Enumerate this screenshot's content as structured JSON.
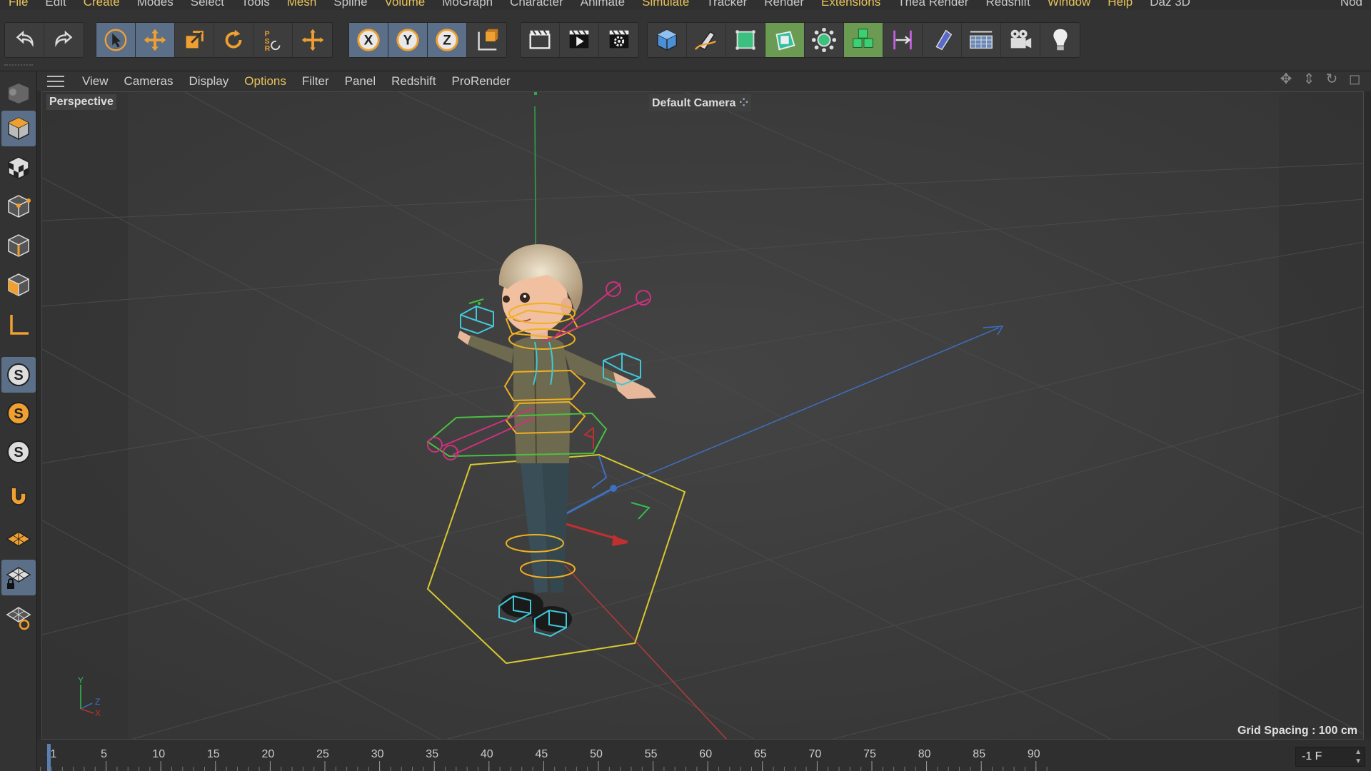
{
  "menu": {
    "items": [
      {
        "label": "File",
        "hl": true
      },
      {
        "label": "Edit",
        "hl": false
      },
      {
        "label": "Create",
        "hl": true
      },
      {
        "label": "Modes",
        "hl": false
      },
      {
        "label": "Select",
        "hl": false
      },
      {
        "label": "Tools",
        "hl": false
      },
      {
        "label": "Mesh",
        "hl": true
      },
      {
        "label": "Spline",
        "hl": false
      },
      {
        "label": "Volume",
        "hl": true
      },
      {
        "label": "MoGraph",
        "hl": false
      },
      {
        "label": "Character",
        "hl": false
      },
      {
        "label": "Animate",
        "hl": false
      },
      {
        "label": "Simulate",
        "hl": true
      },
      {
        "label": "Tracker",
        "hl": false
      },
      {
        "label": "Render",
        "hl": false
      },
      {
        "label": "Extensions",
        "hl": true
      },
      {
        "label": "Thea Render",
        "hl": false
      },
      {
        "label": "Redshift",
        "hl": false
      },
      {
        "label": "Window",
        "hl": true
      },
      {
        "label": "Help",
        "hl": true
      },
      {
        "label": "Daz 3D",
        "hl": false
      }
    ],
    "right_label": "Nod"
  },
  "toolbar": {
    "groups": [
      {
        "buttons": [
          {
            "icon": "undo-icon"
          },
          {
            "icon": "redo-icon"
          }
        ]
      },
      {
        "buttons": [
          {
            "icon": "select-arrow-icon",
            "active": true
          },
          {
            "icon": "move-icon",
            "active": true
          },
          {
            "icon": "scale-icon"
          },
          {
            "icon": "rotate-icon"
          },
          {
            "icon": "psr-icon"
          },
          {
            "icon": "add-icon"
          }
        ]
      },
      {
        "buttons": [
          {
            "icon": "x-axis-icon",
            "active": true
          },
          {
            "icon": "y-axis-icon",
            "active": true
          },
          {
            "icon": "z-axis-icon",
            "active": true
          },
          {
            "icon": "coordinate-system-icon"
          }
        ]
      },
      {
        "buttons": [
          {
            "icon": "render-region-icon"
          },
          {
            "icon": "render-view-icon"
          },
          {
            "icon": "render-settings-icon"
          }
        ]
      },
      {
        "buttons": [
          {
            "icon": "cube-icon"
          },
          {
            "icon": "pen-icon"
          },
          {
            "icon": "subdivision-icon"
          },
          {
            "icon": "extrude-icon",
            "green": true
          },
          {
            "icon": "mograph-cloner-icon"
          },
          {
            "icon": "cubes-icon",
            "green": true
          },
          {
            "icon": "deformer-icon"
          },
          {
            "icon": "field-icon"
          },
          {
            "icon": "floor-icon"
          },
          {
            "icon": "camera-icon"
          },
          {
            "icon": "light-icon"
          }
        ]
      }
    ]
  },
  "leftbar": {
    "buttons": [
      {
        "icon": "make-editable-icon",
        "sel": false
      },
      {
        "icon": "model-mode-icon",
        "sel": true
      },
      {
        "icon": "texture-mode-icon",
        "sel": false
      },
      {
        "icon": "points-mode-icon",
        "sel": false
      },
      {
        "icon": "edges-mode-icon",
        "sel": false
      },
      {
        "icon": "polygons-mode-icon",
        "sel": false
      },
      {
        "icon": "axis-mode-icon",
        "sel": false
      },
      {
        "icon": "snap-icon",
        "sel": true
      },
      {
        "icon": "snap-settings-icon",
        "sel": false
      },
      {
        "icon": "solo-icon",
        "sel": false
      },
      {
        "icon": "magnet-icon",
        "sel": false
      },
      {
        "icon": "workplane-icon",
        "sel": false
      },
      {
        "icon": "lock-workplane-icon",
        "sel": true
      },
      {
        "icon": "workplane-rotate-icon",
        "sel": false
      }
    ]
  },
  "viewport_menu": {
    "items": [
      {
        "label": "View",
        "hl": false
      },
      {
        "label": "Cameras",
        "hl": false
      },
      {
        "label": "Display",
        "hl": false
      },
      {
        "label": "Options",
        "hl": true
      },
      {
        "label": "Filter",
        "hl": false
      },
      {
        "label": "Panel",
        "hl": false
      },
      {
        "label": "Redshift",
        "hl": false
      },
      {
        "label": "ProRender",
        "hl": false
      }
    ]
  },
  "viewport": {
    "view_name": "Perspective",
    "camera_name": "Default Camera",
    "grid_spacing": "Grid Spacing : 100 cm",
    "axis_labels": {
      "y": "Y",
      "z": "Z",
      "x": "X"
    }
  },
  "timeline": {
    "ticks": [
      "-1",
      "5",
      "10",
      "15",
      "20",
      "25",
      "30",
      "35",
      "40",
      "45",
      "50",
      "55",
      "60",
      "65",
      "70",
      "75",
      "80",
      "85",
      "90"
    ],
    "current_frame": "-1 F"
  }
}
